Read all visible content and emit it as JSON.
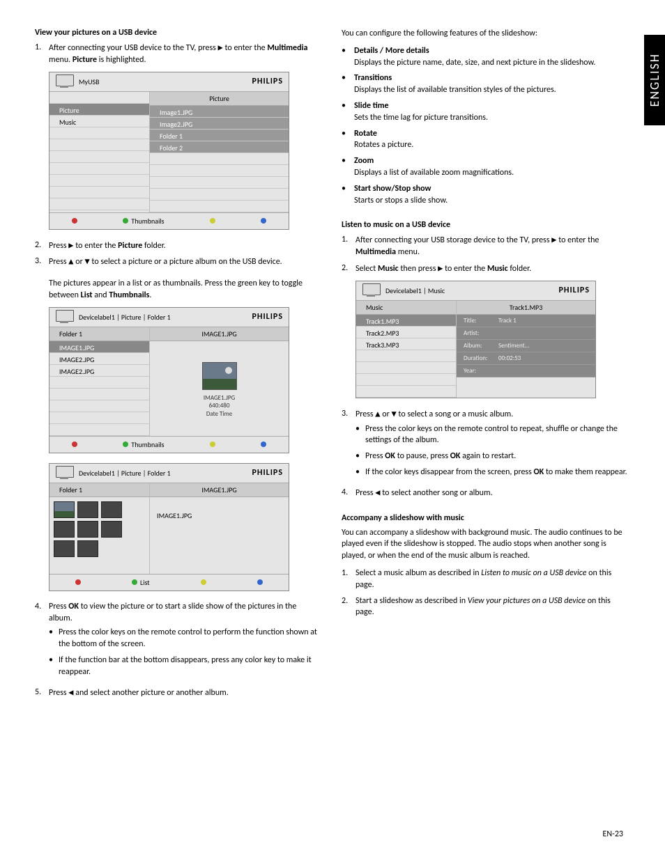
{
  "language_tab": "ENGLISH",
  "page_number": "EN-23",
  "left": {
    "h1": "View your pictures on a USB device",
    "step1_a": "After connecting your USB device to the TV, press ",
    "step1_b": " to enter the ",
    "step1_c": "Multimedia",
    "step1_d": " menu.  ",
    "step1_e": "Picture",
    "step1_f": " is highlighted.",
    "ss1": {
      "breadcrumb": "MyUSB",
      "brand": "PHILIPS",
      "right_head": "Picture",
      "left_rows": [
        "Picture",
        "Music"
      ],
      "right_rows": [
        "Image1.JPG",
        "Image2.JPG",
        "Folder 1",
        "Folder 2"
      ],
      "footer_label": "Thumbnails"
    },
    "step2_a": "Press ",
    "step2_b": " to enter the ",
    "step2_c": "Picture",
    "step2_d": " folder.",
    "step3_a": "Press ",
    "step3_b": " or ",
    "step3_c": " to select a picture or a picture album on the USB device.",
    "step3_note_a": "The pictures appear in a list or as thumbnails.  Press the green key to toggle between ",
    "step3_note_b": "List",
    "step3_note_c": " and ",
    "step3_note_d": "Thumbnails",
    "step3_note_e": ".",
    "ss2": {
      "breadcrumb": "Devicelabel1 | Picture | Folder 1",
      "brand": "PHILIPS",
      "left_head": "Folder 1",
      "right_head": "IMAGE1.JPG",
      "left_rows": [
        "IMAGE1.JPG",
        "IMAGE2.JPG",
        "IMAGE2.JPG"
      ],
      "preview_caption1": "IMAGE1.JPG",
      "preview_caption2": "640:480",
      "preview_caption3": "Date   Time",
      "footer_label": "Thumbnails"
    },
    "ss3": {
      "breadcrumb": "Devicelabel1 | Picture | Folder 1",
      "brand": "PHILIPS",
      "left_head": "Folder 1",
      "right_head": "IMAGE1.JPG",
      "right_caption": "IMAGE1.JPG",
      "footer_label": "List"
    },
    "step4_a": "Press ",
    "step4_b": "OK",
    "step4_c": " to view the picture or to start a slide show of the pictures in the album.",
    "step4_sub1": "Press the color keys on the remote control to perform the function shown at the bottom of the screen.",
    "step4_sub2": "If the function bar at the bottom disappears, press any color key to make it reappear.",
    "step5_a": "Press ",
    "step5_b": " and select another picture or another album."
  },
  "right": {
    "intro": "You can configure the following features of the slideshow:",
    "f1_t": "Details / More details",
    "f1_d": "Displays the picture name, date, size, and next picture in the slideshow.",
    "f2_t": "Transitions",
    "f2_d": "Displays the list of available transition styles of the pictures.",
    "f3_t": "Slide time",
    "f3_d": "Sets the time lag for picture transitions.",
    "f4_t": "Rotate",
    "f4_d": "Rotates a picture.",
    "f5_t": "Zoom",
    "f5_d": "Displays a list of available zoom magnifications.",
    "f6_t": "Start show/Stop show",
    "f6_d": "Starts or stops a slide show.",
    "h2": "Listen to music on a USB device",
    "m1_a": "After connecting your USB storage device to the TV, press ",
    "m1_b": " to enter the ",
    "m1_c": "Multimedia",
    "m1_d": " menu.",
    "m2_a": "Select ",
    "m2_b": "Music",
    "m2_c": " then press ",
    "m2_d": " to enter the ",
    "m2_e": "Music",
    "m2_f": " folder.",
    "ss4": {
      "breadcrumb": "Devicelabel1 | Music",
      "brand": "PHILIPS",
      "left_head": "Music",
      "right_head": "Track1.MP3",
      "left_rows": [
        "Track1.MP3",
        "Track2.MP3",
        "Track3.MP3"
      ],
      "meta": [
        {
          "k": "Title:",
          "v": "Track 1"
        },
        {
          "k": "Artist:",
          "v": ""
        },
        {
          "k": "Album:",
          "v": "Sentiment..."
        },
        {
          "k": "Duration:",
          "v": "00:02:53"
        },
        {
          "k": "Year:",
          "v": ""
        }
      ]
    },
    "m3_a": "Press ",
    "m3_b": " or ",
    "m3_c": " to select a song or a music album.",
    "m3_sub1": "Press the color keys on the remote control to repeat, shuffle or change the settings of the album.",
    "m3_sub2_a": "Press ",
    "m3_sub2_b": "OK",
    "m3_sub2_c": " to pause, press ",
    "m3_sub2_d": "OK",
    "m3_sub2_e": " again to restart.",
    "m3_sub3_a": "If the color keys disappear from the screen, press ",
    "m3_sub3_b": "OK",
    "m3_sub3_c": " to make them reappear.",
    "m4_a": "Press ",
    "m4_b": " to select another song or album.",
    "h3": "Accompany a slideshow with music",
    "acc_intro": "You can accompany a slideshow with background music.  The audio continues to be played even if the slideshow is stopped.  The audio stops when another song is played, or when the end of the music album is reached.",
    "a1_a": "Select a music album as described in ",
    "a1_b": "Listen to music on a USB device",
    "a1_c": " on this page.",
    "a2_a": "Start a slideshow as described in ",
    "a2_b": "View your pictures on a USB device",
    "a2_c": " on this page."
  },
  "glyph": {
    "right": "▶",
    "left": "◀",
    "up": "▲",
    "down": "▼"
  }
}
